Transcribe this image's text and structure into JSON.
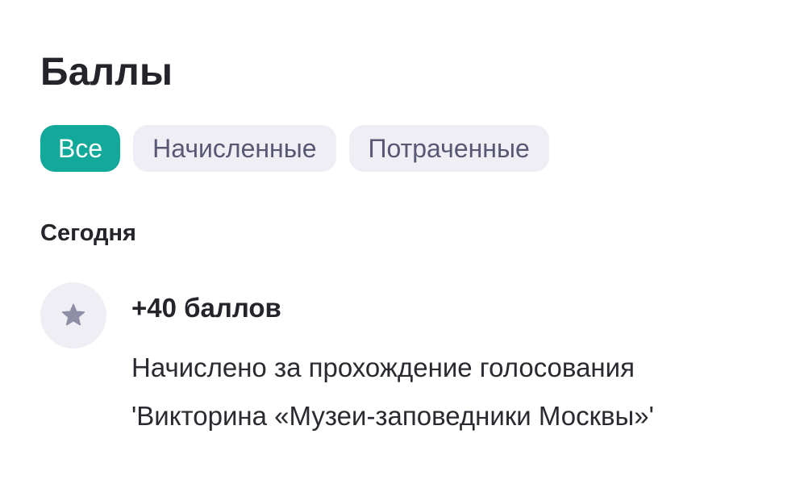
{
  "header": {
    "title": "Баллы"
  },
  "tabs": [
    {
      "label": "Все",
      "active": true
    },
    {
      "label": "Начисленные",
      "active": false
    },
    {
      "label": "Потраченные",
      "active": false
    }
  ],
  "colors": {
    "accent": "#12a89a",
    "chip_bg": "#efeef4",
    "chip_text": "#585874",
    "icon": "#8e8ea6"
  },
  "history": {
    "group_label": "Сегодня",
    "items": [
      {
        "icon": "star-icon",
        "points": "+40 баллов",
        "description": "Начислено за прохождение голосования 'Викторина «Музеи-заповедники Москвы»'"
      }
    ]
  }
}
